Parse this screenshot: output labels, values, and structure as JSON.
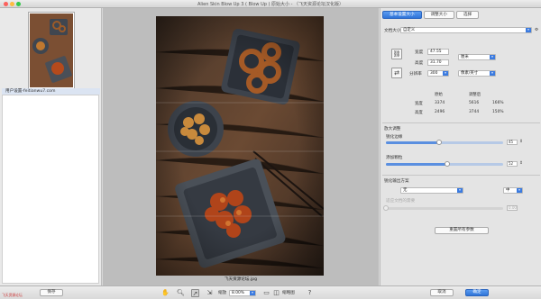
{
  "window": {
    "title": "Alien Skin Blow Up 3 ( Blow Up ) 原始大小 - （飞天资源论坛汉化版）"
  },
  "left_panel": {
    "thumbnail_label": "用户设置-feitianwu7.com"
  },
  "canvas": {
    "photo_caption": "飞天资源论坛.jpg"
  },
  "right_panel": {
    "tabs": [
      {
        "label": "基本设置大小",
        "active": true
      },
      {
        "label": "调整大小",
        "active": false
      },
      {
        "label": "选择",
        "active": false
      }
    ],
    "doc_size_label": "文档大小",
    "doc_size_value": "自定义",
    "width_label": "宽度",
    "width_value": "47.55",
    "height_label": "高度",
    "height_value": "31.70",
    "unit_value": "厘米",
    "resolution_label": "分辨率",
    "resolution_value": "300",
    "resolution_unit": "像素/英寸",
    "table": {
      "col_original": "原始",
      "col_adjusted": "调整后",
      "rows": [
        {
          "label": "宽度",
          "original": "3374",
          "adjusted": "5616",
          "pct": "166%"
        },
        {
          "label": "高度",
          "original": "2496",
          "adjusted": "3744",
          "pct": "150%"
        }
      ]
    },
    "enlarge_section": "放大调整",
    "sharpen_label": "锐化边缘",
    "sharpen_value": "45",
    "sharpen_fraction": 0.45,
    "grain_label": "添加颗粒",
    "grain_value": "52",
    "grain_fraction": 0.52,
    "sharpen_type_section": "锐化输出方案",
    "sharpen_type_value": "无",
    "sharpen_amount_value": "中",
    "disabled_label": "适应文档的需要",
    "disabled_value": "0.00",
    "reset_button": "重置所有参数"
  },
  "bottom_bar": {
    "save_button": "保存",
    "zoom_label": "缩放",
    "zoom_value": "8.00%",
    "fit_label": "缩略图",
    "cancel_button": "取消",
    "ok_button": "确定",
    "watermark": "飞天资源论坛"
  },
  "colors": {
    "accent": "#2f74d8",
    "photo_bg": "#3a2b21"
  }
}
